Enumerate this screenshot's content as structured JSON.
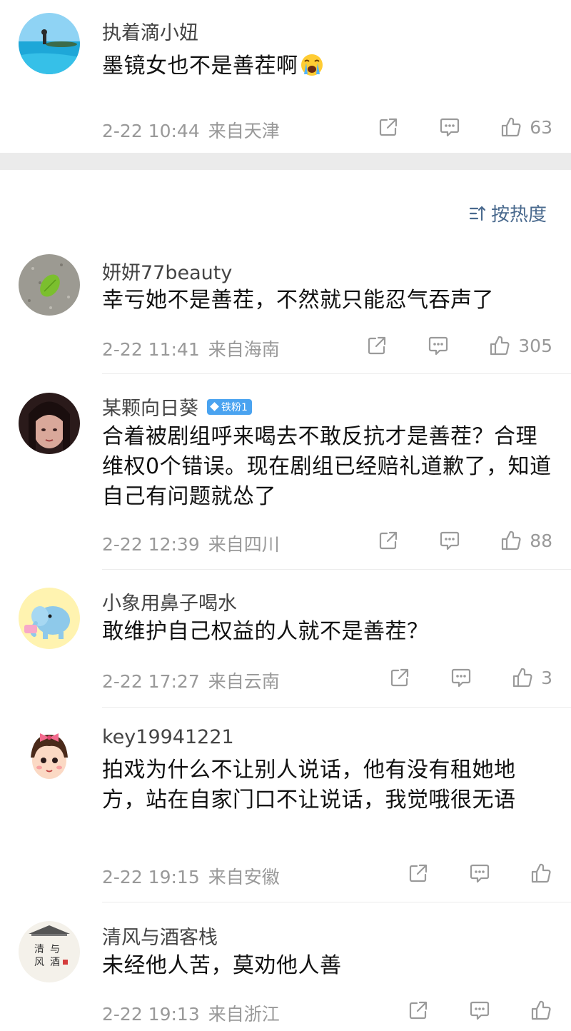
{
  "sort": {
    "label": "按热度"
  },
  "top_comment": {
    "username": "执着滴小妞",
    "text": "墨镜女也不是善茬啊",
    "emoji": "crying-face-emoji",
    "date": "2-22 10:44",
    "location": "来自天津",
    "likes": "63"
  },
  "comments": [
    {
      "username": "妍妍77beauty",
      "text": "幸亏她不是善茬，不然就只能忍气吞声了",
      "date": "2-22 11:41",
      "location": "来自海南",
      "likes": "305"
    },
    {
      "username": "某颗向日葵",
      "badge": "铁粉1",
      "text": "合着被剧组呼来喝去不敢反抗才是善茬？合理维权0个错误。现在剧组已经赔礼道歉了，知道自己有问题就怂了",
      "date": "2-22 12:39",
      "location": "来自四川",
      "likes": "88"
    },
    {
      "username": "小象用鼻子喝水",
      "text": "敢维护自己权益的人就不是善茬？",
      "date": "2-22 17:27",
      "location": "来自云南",
      "likes": "3"
    },
    {
      "username": "key19941221",
      "text": "拍戏为什么不让别人说话，他有没有租她地方，站在自家门口不让说话，我觉哦很无语",
      "date": "2-22 19:15",
      "location": "来自安徽",
      "likes": ""
    },
    {
      "username": "清风与酒客栈",
      "text": "未经他人苦，莫劝他人善",
      "date": "2-22 19:13",
      "location": "来自浙江",
      "likes": ""
    }
  ],
  "colors": {
    "link_blue": "#4a6a8e",
    "meta_gray": "#999999",
    "badge_blue": "#4aa3f0",
    "section_gap": "#ebebeb"
  },
  "icons": {
    "share": "share-icon",
    "reply": "comment-icon",
    "like": "thumbs-up-icon",
    "sort": "sort-icon"
  }
}
